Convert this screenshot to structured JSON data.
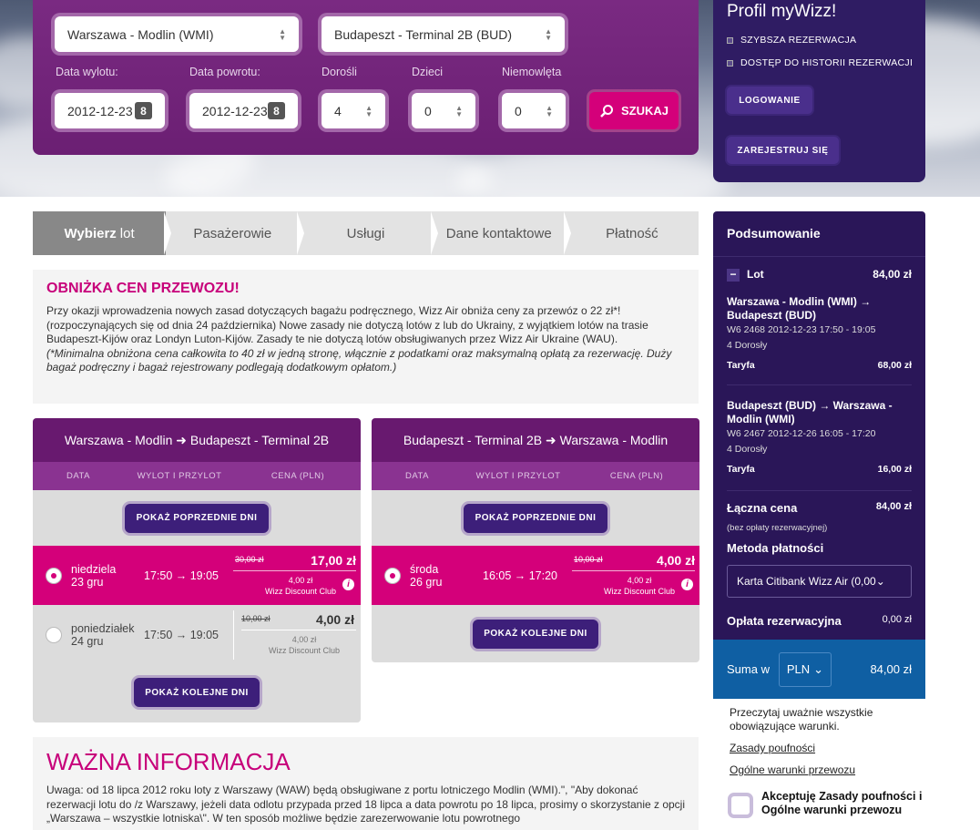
{
  "search": {
    "from": "Warszawa - Modlin (WMI)",
    "to": "Budapeszt - Terminal 2B (BUD)",
    "depart_label": "Data wylotu:",
    "return_label": "Data powrotu:",
    "adults_label": "Dorośli",
    "children_label": "Dzieci",
    "infants_label": "Niemowlęta",
    "depart_date": "2012-12-23",
    "return_date": "2012-12-23",
    "adults": "4",
    "children": "0",
    "infants": "0",
    "cal_icon_text": "8",
    "search_btn": "SZUKAJ"
  },
  "profile": {
    "title": "Profil myWizz!",
    "bullets": [
      "SZYBSZA REZERWACJA",
      "DOSTĘP DO HISTORII REZERWACJI"
    ],
    "login_btn": "LOGOWANIE",
    "register_btn": "ZAREJESTRUJ SIĘ"
  },
  "steps": {
    "s1_bold": "Wybierz",
    "s1_rest": "lot",
    "s2": "Pasażerowie",
    "s3": "Usługi",
    "s4": "Dane kontaktowe",
    "s5": "Płatność"
  },
  "notice": {
    "title": "OBNIŻKA CEN PRZEWOZU!",
    "body": "Przy okazji wprowadzenia nowych zasad dotyczących bagażu podręcznego, Wizz Air obniża ceny za przewóz o 22 zł*! (rozpoczynających się od dnia 24 października) Nowe zasady nie dotyczą lotów z lub do Ukrainy, z wyjątkiem lotów na trasie Budapeszt-Kijów oraz Londyn Luton-Kijów. Zasady te nie dotyczą lotów obsługiwanych przez Wizz Air Ukraine (WAU).",
    "note": "(*Minimalna obniżona cena całkowita to 40 zł w jedną stronę, włącznie z podatkami oraz maksymalną opłatą za rezerwację. Duży bagaż podręczny i bagaż rejestrowany podlegają dodatkowym opłatom.)"
  },
  "outbound": {
    "title": "Warszawa - Modlin ➜ Budapeszt - Terminal 2B",
    "col_date": "DATA",
    "col_time": "WYLOT I PRZYLOT",
    "col_price": "CENA (PLN)",
    "prev_btn": "POKAŻ POPRZEDNIE DNI",
    "next_btn": "POKAŻ KOLEJNE DNI",
    "rows": [
      {
        "day": "niedziela",
        "date": "23 gru",
        "time": "17:50 → 19:05",
        "old": "30,00 zł",
        "price": "17,00 zł",
        "club_price": "4,00 zł",
        "club": "Wizz Discount Club"
      },
      {
        "day": "poniedziałek",
        "date": "24 gru",
        "time": "17:50 → 19:05",
        "old": "10,00 zł",
        "price": "4,00 zł",
        "club_price": "4,00 zł",
        "club": "Wizz Discount Club"
      }
    ]
  },
  "inbound": {
    "title": "Budapeszt - Terminal 2B ➜ Warszawa - Modlin",
    "col_date": "DATA",
    "col_time": "WYLOT I PRZYLOT",
    "col_price": "CENA (PLN)",
    "prev_btn": "POKAŻ POPRZEDNIE DNI",
    "next_btn": "POKAŻ KOLEJNE DNI",
    "rows": [
      {
        "day": "środa",
        "date": "26 gru",
        "time": "16:05 → 17:20",
        "old": "10,00 zł",
        "price": "4,00 zł",
        "club_price": "4,00 zł",
        "club": "Wizz Discount Club"
      }
    ]
  },
  "important": {
    "title": "WAŻNA INFORMACJA",
    "body": "Uwaga: od 18 lipca 2012 roku loty z Warszawy (WAW) będą obsługiwane z portu lotniczego Modlin (WMI).\", \"Aby dokonać rezerwacji lotu do /z Warszawy, jeżeli data odlotu przypada przed 18 lipca a data powrotu po 18 lipca, prosimy o skorzystanie z opcji „Warszawa – wszystkie lotniska\\\". W ten sposób możliwe będzie zarezerwowanie lotu powrotnego"
  },
  "summary": {
    "title": "Podsumowanie",
    "flight_label": "Lot",
    "flight_total": "84,00 zł",
    "leg1_route": "Warszawa - Modlin (WMI) → Budapeszt (BUD)",
    "leg1_info": "W6 2468  2012-12-23 17:50 - 19:05",
    "leg1_pax": "4 Dorosły",
    "fare_label": "Taryfa",
    "leg1_fare": "68,00 zł",
    "leg2_route": "Budapeszt (BUD) → Warszawa - Modlin (WMI)",
    "leg2_info": "W6 2467  2012-12-26 16:05 - 17:20",
    "leg2_pax": "4 Dorosły",
    "leg2_fare": "16,00 zł",
    "total_label": "Łączna cena",
    "total_value": "84,00 zł",
    "total_note": "(bez opłaty rezerwacyjnej)",
    "payment_label": "Metoda płatności",
    "payment_value": "Karta Citibank Wizz Air (0,00",
    "booking_fee_label": "Opłata rezerwacyjna",
    "booking_fee_value": "0,00 zł",
    "sum_label": "Suma w",
    "currency": "PLN",
    "sum_value": "84,00 zł",
    "terms_text": "Przeczytaj uważnie wszystkie obowiązujące warunki.",
    "privacy_link": "Zasady poufności",
    "general_link": "Ogólne warunki przewozu",
    "accept_label": "Akceptuję Zasady poufności i Ogólne warunki przewozu"
  }
}
